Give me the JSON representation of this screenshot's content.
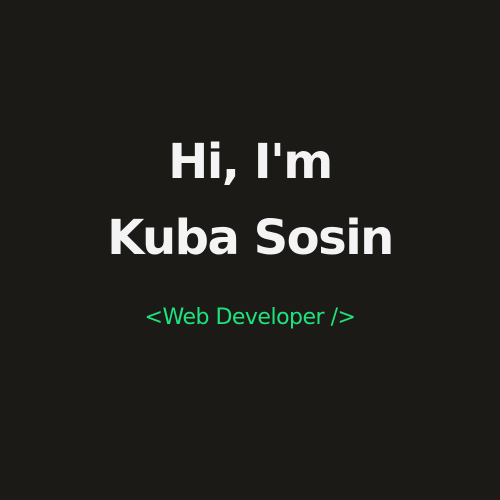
{
  "hero": {
    "greeting": "Hi, I'm",
    "name": "Kuba Sosin",
    "role": "<Web Developer />"
  },
  "colors": {
    "background": "#1b1a17",
    "heading": "#f4f4f4",
    "accent": "#1ee37c"
  }
}
